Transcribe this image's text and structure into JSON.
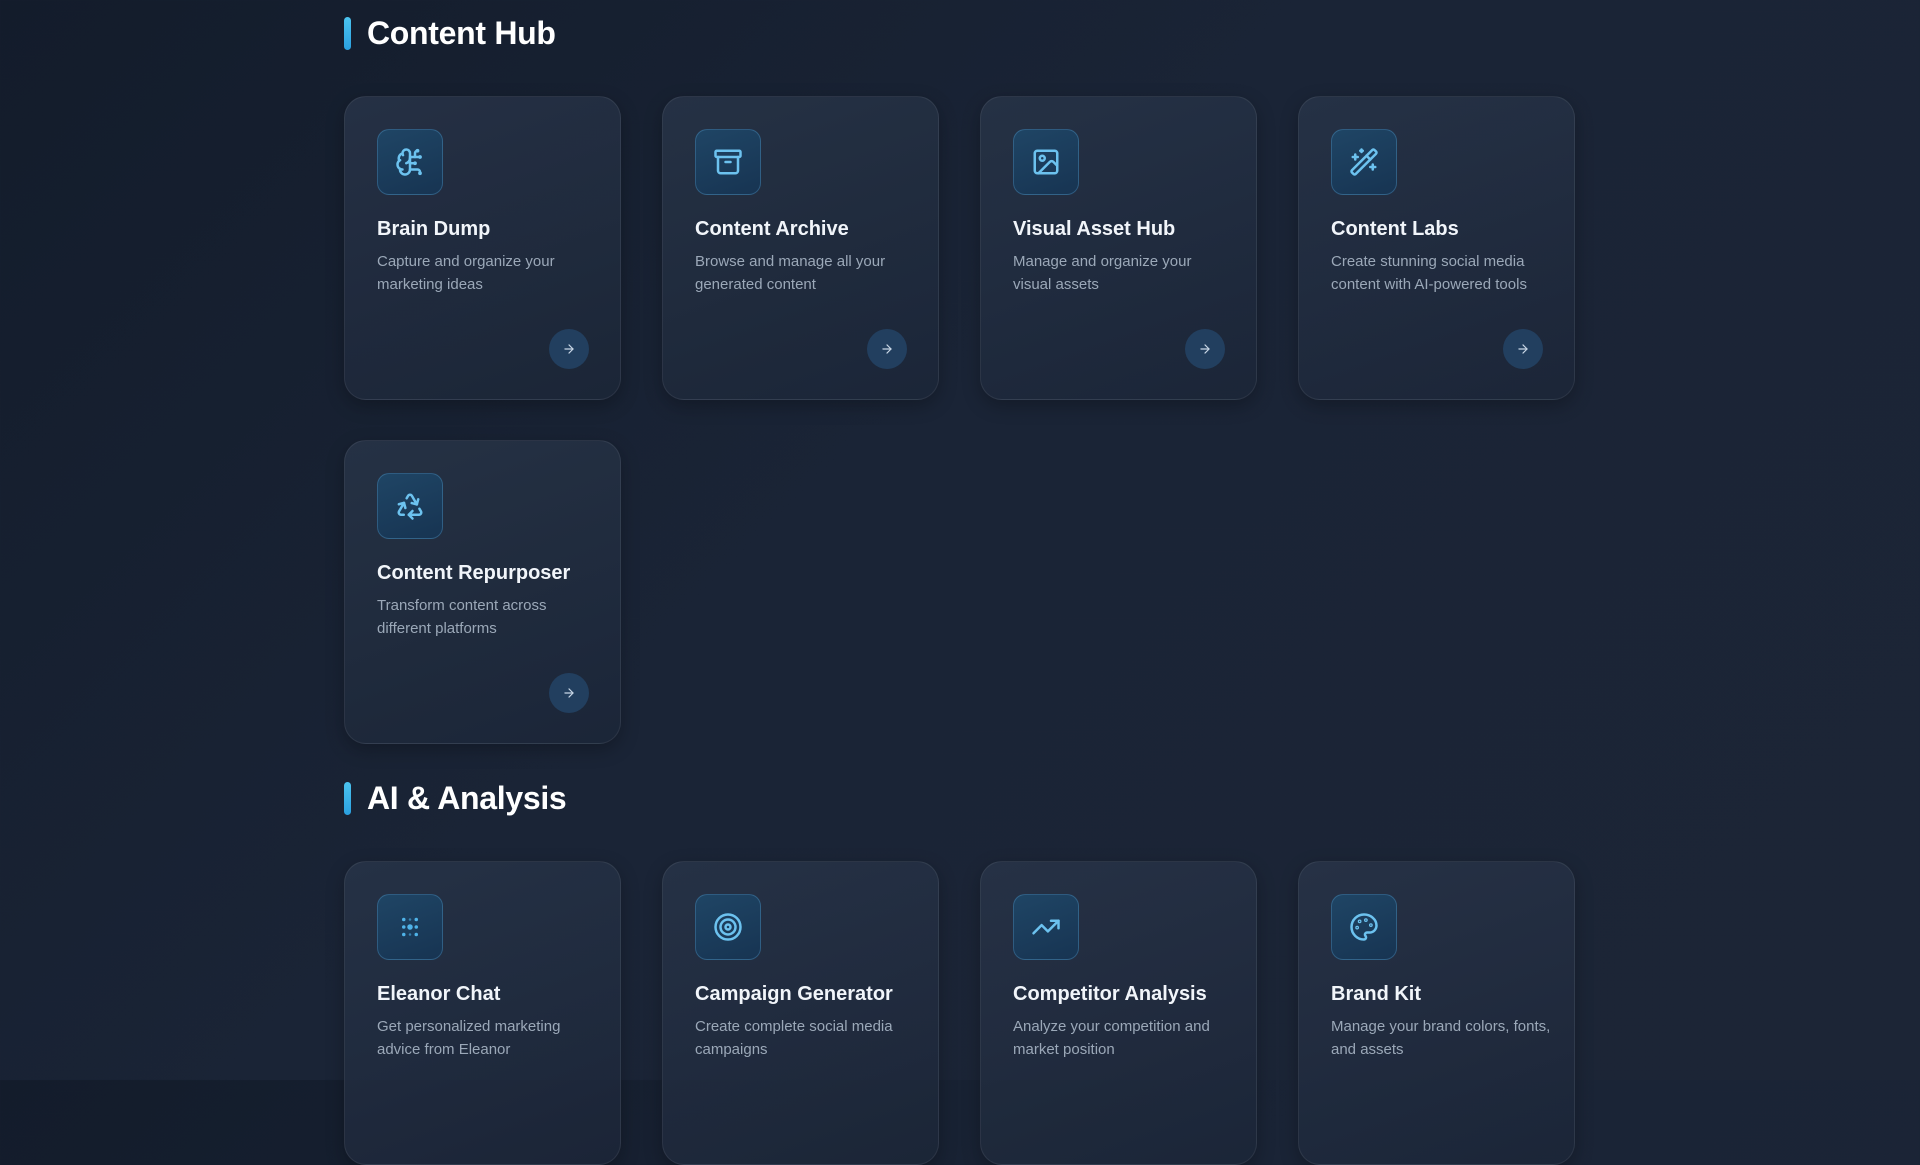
{
  "sections": [
    {
      "title": "Content Hub",
      "cards": [
        {
          "title": "Brain Dump",
          "description": "Capture and organize your marketing ideas",
          "icon": "brain-icon"
        },
        {
          "title": "Content Archive",
          "description": "Browse and manage all your generated content",
          "icon": "archive-icon"
        },
        {
          "title": "Visual Asset Hub",
          "description": "Manage and organize your visual assets",
          "icon": "image-icon"
        },
        {
          "title": "Content Labs",
          "description": "Create stunning social media content with AI-powered tools",
          "icon": "magic-wand-icon"
        },
        {
          "title": "Content Repurposer",
          "description": "Transform content across different platforms",
          "icon": "recycle-icon"
        }
      ]
    },
    {
      "title": "AI & Analysis",
      "cards": [
        {
          "title": "Eleanor Chat",
          "description": "Get personalized marketing advice from Eleanor",
          "icon": "dots-grid-icon"
        },
        {
          "title": "Campaign Generator",
          "description": "Create complete social media campaigns",
          "icon": "target-icon"
        },
        {
          "title": "Competitor Analysis",
          "description": "Analyze your competition and market position",
          "icon": "trending-up-icon"
        },
        {
          "title": "Brand Kit",
          "description": "Manage your brand colors, fonts, and assets",
          "icon": "palette-icon"
        }
      ]
    }
  ],
  "colors": {
    "accent": "#4cc4f0",
    "icon_stroke": "#6cc2ef",
    "background": "#1a2436",
    "card_background": "#243044"
  }
}
